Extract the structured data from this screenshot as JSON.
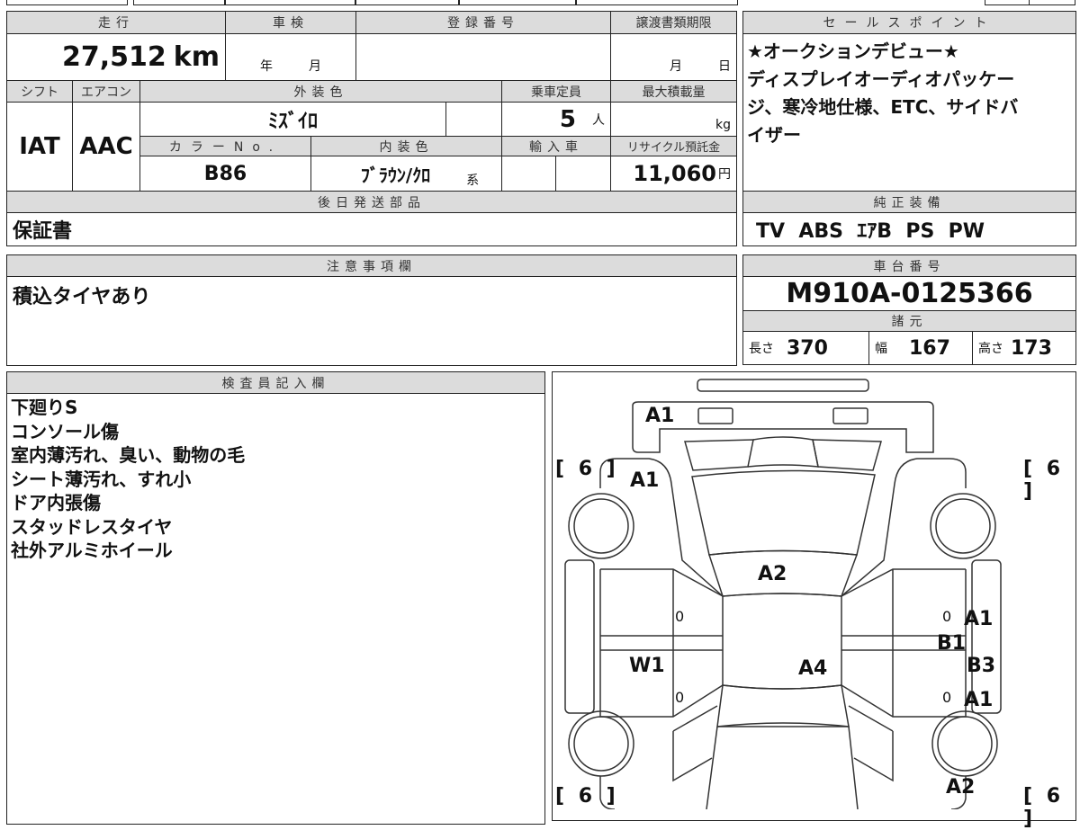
{
  "odometer": {
    "label": "走行",
    "value": "27,512",
    "unit": "km"
  },
  "inspection": {
    "label": "車検",
    "year_unit": "年",
    "month_unit": "月"
  },
  "registration": {
    "label": "登録番号",
    "value": ""
  },
  "transfer_deadline": {
    "label": "譲渡書類期限",
    "month_unit": "月",
    "day_unit": "日"
  },
  "shift": {
    "label": "シフト",
    "value": "IAT"
  },
  "aircon": {
    "label": "エアコン",
    "value": "AAC"
  },
  "exterior_color": {
    "label": "外装色",
    "value": "ﾐｽﾞｲﾛ"
  },
  "capacity": {
    "label": "乗車定員",
    "value": "5",
    "unit": "人"
  },
  "max_load": {
    "label": "最大積載量",
    "value": "",
    "unit": "kg"
  },
  "color_no": {
    "label": "カラーNo.",
    "value": "B86"
  },
  "interior_color": {
    "label": "内装色",
    "value": "ﾌﾞﾗｳﾝ/ｸﾛ",
    "suffix": "系"
  },
  "imported": {
    "label": "輸入車",
    "value": ""
  },
  "recycle_fee": {
    "label": "リサイクル預託金",
    "value": "11,060",
    "unit": "円"
  },
  "later_parts": {
    "label": "後日発送部品",
    "value": "保証書"
  },
  "sales_points": {
    "label": "セールスポイント",
    "lines": [
      "★オークションデビュー★",
      "ディスプレイオーディオパッケー",
      "ジ、寒冷地仕様、ETC、サイドバ",
      "イザー"
    ]
  },
  "standard_equipment": {
    "label": "純正装備",
    "value": "TV  ABS  ｴｱB  PS  PW"
  },
  "notes": {
    "label": "注意事項欄",
    "value": "積込タイヤあり"
  },
  "chassis_number": {
    "label": "車台番号",
    "value": "M910A-0125366"
  },
  "specs": {
    "label": "諸元",
    "length_label": "長さ",
    "length": "370",
    "width_label": "幅",
    "width": "167",
    "height_label": "高さ",
    "height": "173"
  },
  "inspector": {
    "label": "検査員記入欄",
    "lines": [
      "下廻りS",
      "コンソール傷",
      "室内薄汚れ、臭い、動物の毛",
      "シート薄汚れ、すれ小",
      "ドア内張傷",
      "スタッドレスタイヤ",
      "社外アルミホイール"
    ]
  },
  "diagram": {
    "tread_fl": "[ 6 ]",
    "tread_fr": "[ 6 ]",
    "tread_rl": "[ 6 ]",
    "tread_rr": "[ 6 ]",
    "front_bumper": "A1",
    "front_left_fender": "A1",
    "windshield": "A2",
    "roof": "A4",
    "left_front_door": "0",
    "left_rear_door": "0",
    "left_rear_door_mark": "W1",
    "right_front_door": "0",
    "right_rear_door": "0",
    "right_front_door_mark": "A1",
    "right_pillar_mark": "B1",
    "right_rear_mark": "B3",
    "right_rear_door_mark": "A1",
    "right_rear_fender": "A2"
  }
}
